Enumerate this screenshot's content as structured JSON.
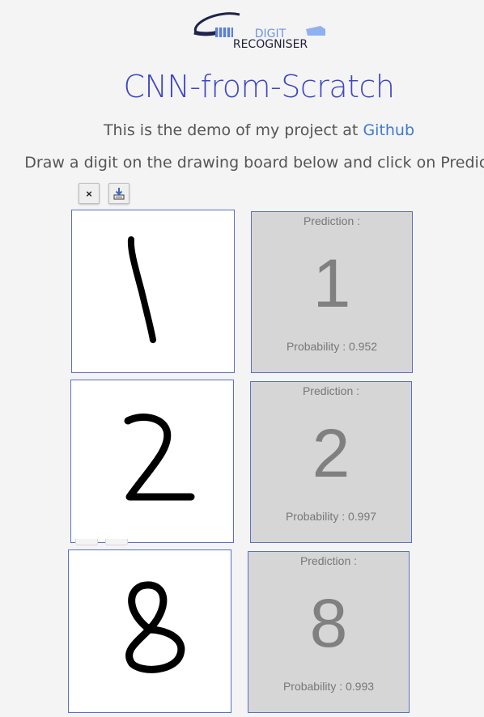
{
  "logo": {
    "top_text": "DIGIT",
    "bottom_text": "RECOGNISER"
  },
  "header": {
    "title": "CNN-from-Scratch",
    "intro_prefix": "This is the demo of my project at ",
    "intro_link": "Github",
    "instruction": "Draw a digit on the drawing board below and click on Predict"
  },
  "toolbar": {
    "clear_icon_glyph": "×",
    "icons": [
      "close-icon",
      "download-icon"
    ]
  },
  "predictions": [
    {
      "label": "Prediction :",
      "digit": "1",
      "probability_text": "Probability : 0.952",
      "probability": 0.952
    },
    {
      "label": "Prediction :",
      "digit": "2",
      "probability_text": "Probability : 0.997",
      "probability": 0.997
    },
    {
      "label": "Prediction :",
      "digit": "8",
      "probability_text": "Probability : 0.993",
      "probability": 0.993
    }
  ],
  "colors": {
    "accent": "#3f46c4",
    "link": "#3f7ad0",
    "border": "#5a6fc7",
    "panel": "#d6d6d6"
  }
}
